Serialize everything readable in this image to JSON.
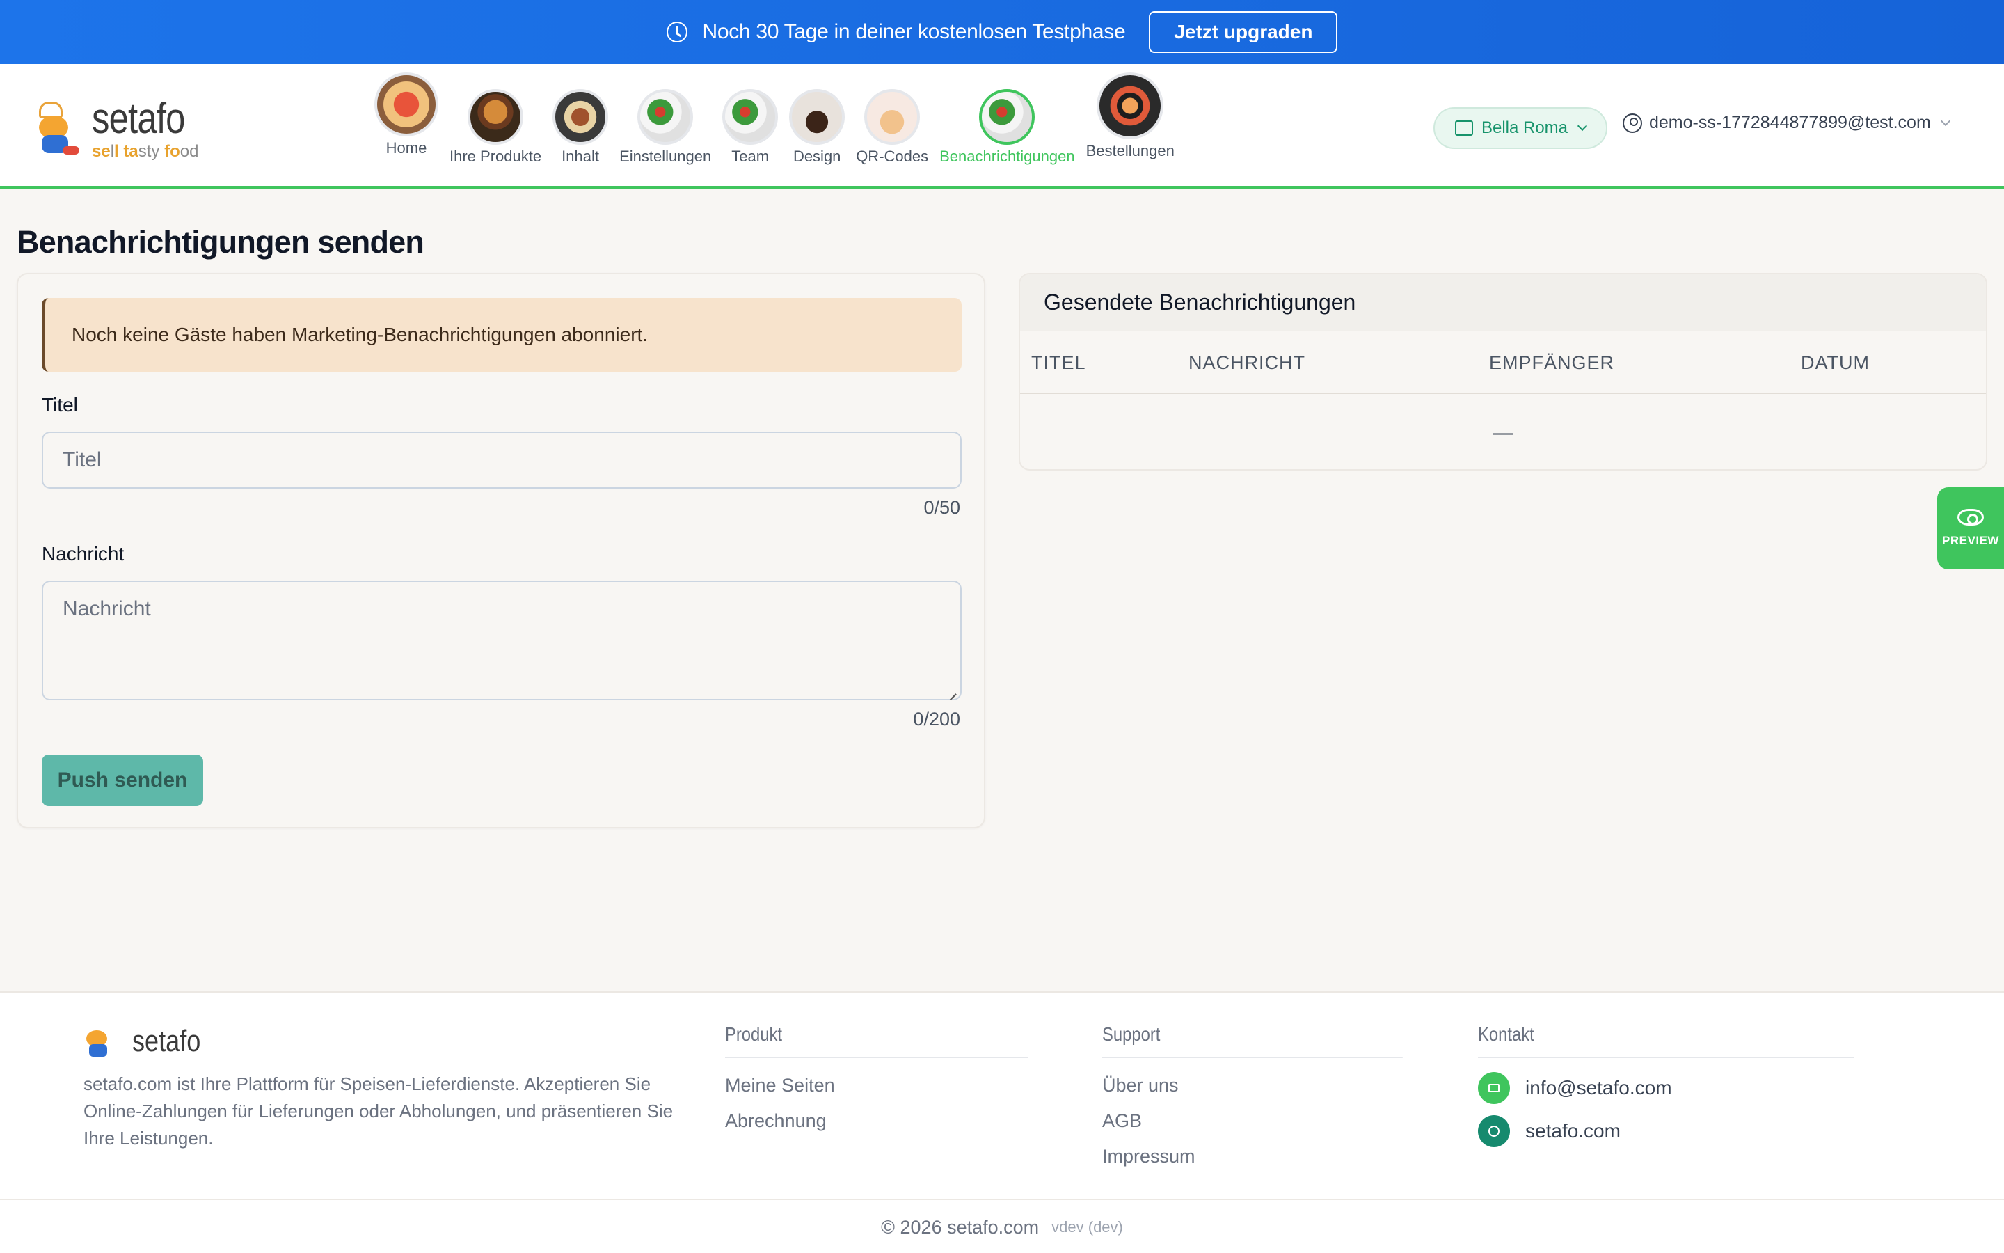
{
  "banner": {
    "text": "Noch 30 Tage in deiner kostenlosen Testphase",
    "upgrade_label": "Jetzt upgraden"
  },
  "brand": {
    "name": "setafo",
    "tagline": "sell tasty food"
  },
  "nav": {
    "items": [
      {
        "label": "Home",
        "icon": "pizza"
      },
      {
        "label": "Ihre Produkte",
        "icon": "burger"
      },
      {
        "label": "Inhalt",
        "icon": "plate"
      },
      {
        "label": "Einstellungen",
        "icon": "salad"
      },
      {
        "label": "Team",
        "icon": "salad"
      },
      {
        "label": "Design",
        "icon": "cake"
      },
      {
        "label": "QR-Codes",
        "icon": "hand"
      },
      {
        "label": "Benachrichtigungen",
        "icon": "salad",
        "active": true
      },
      {
        "label": "Bestellungen",
        "icon": "sushi"
      }
    ]
  },
  "branch_selector": {
    "label": "Bella Roma"
  },
  "user_menu": {
    "email": "demo-ss-1772844877899@test.com"
  },
  "page": {
    "title": "Benachrichtigungen senden"
  },
  "form": {
    "alert": "Noch keine Gäste haben Marketing-Benachrichtigungen abonniert.",
    "title_label": "Titel",
    "title_placeholder": "Titel",
    "title_counter": "0/50",
    "message_label": "Nachricht",
    "message_placeholder": "Nachricht",
    "message_counter": "0/200",
    "submit_label": "Push senden"
  },
  "sent": {
    "heading": "Gesendete Benachrichtigungen",
    "columns": [
      "TITEL",
      "NACHRICHT",
      "EMPFÄNGER",
      "DATUM"
    ],
    "empty": "—"
  },
  "preview": {
    "label": "PREVIEW"
  },
  "footer": {
    "brand": "setafo",
    "description": "setafo.com ist Ihre Plattform für Speisen-Lieferdienste. Akzeptieren Sie Online-Zahlungen für Lieferungen oder Abholungen, und präsentieren Sie Ihre Leistungen.",
    "produkt": {
      "heading": "Produkt",
      "links": [
        "Meine Seiten",
        "Abrechnung"
      ]
    },
    "support": {
      "heading": "Support",
      "links": [
        "Über uns",
        "AGB",
        "Impressum"
      ]
    },
    "kontakt": {
      "heading": "Kontakt",
      "email": "info@setafo.com",
      "web": "setafo.com"
    },
    "copyright": "© 2026 setafo.com",
    "version": "vdev (dev)"
  },
  "colors": {
    "accent_green": "#3fc55d",
    "banner_blue": "#1d74ea",
    "teal": "#17936b",
    "button_teal": "#5eb8a9"
  }
}
